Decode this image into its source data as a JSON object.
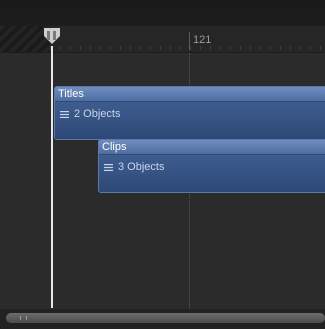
{
  "ruler": {
    "timecode_label": "121"
  },
  "layers": [
    {
      "title": "Titles",
      "content_label": "2 Objects"
    },
    {
      "title": "Clips",
      "content_label": "3 Objects"
    }
  ],
  "colors": {
    "band_title": "#6f8dc0",
    "band_body": "#2f4b78",
    "playhead": "#e8e8e8",
    "background": "#2b2b2b"
  },
  "icons": {
    "playhead": "playhead-flag-icon",
    "group": "stack-lines-icon",
    "scroll_grip": "grip-icon"
  }
}
